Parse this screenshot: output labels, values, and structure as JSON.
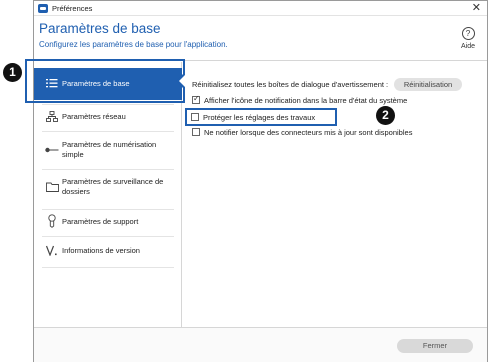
{
  "window": {
    "title": "Préférences"
  },
  "header": {
    "title": "Paramètres de base",
    "subtitle": "Configurez les paramètres de base pour l'application.",
    "help_label": "Aide",
    "help_glyph": "?"
  },
  "sidebar": {
    "items": [
      {
        "label": "Paramètres de base",
        "icon": "list-icon"
      },
      {
        "label": "Paramètres réseau",
        "icon": "network-icon"
      },
      {
        "label": "Paramètres de numérisation simple",
        "icon": "scan-icon"
      },
      {
        "label": "Paramètres de surveillance de dossiers",
        "icon": "folder-icon"
      },
      {
        "label": "Paramètres de support",
        "icon": "support-icon"
      },
      {
        "label": "Informations de version",
        "icon": "version-icon"
      }
    ]
  },
  "content": {
    "reset_text": "Réinitialisez toutes les boîtes de dialogue d'avertissement :",
    "reset_button": "Réinitialisation",
    "option_notification": "Afficher l'icône de notification dans la barre d'état du système",
    "option_protect": "Protéger les réglages des travaux",
    "option_updates": "Ne notifier lorsque des connecteurs mis à jour sont disponibles"
  },
  "footer": {
    "close_button": "Fermer"
  },
  "callouts": {
    "one": "1",
    "two": "2"
  },
  "colors": {
    "accent": "#1f5fb0"
  }
}
